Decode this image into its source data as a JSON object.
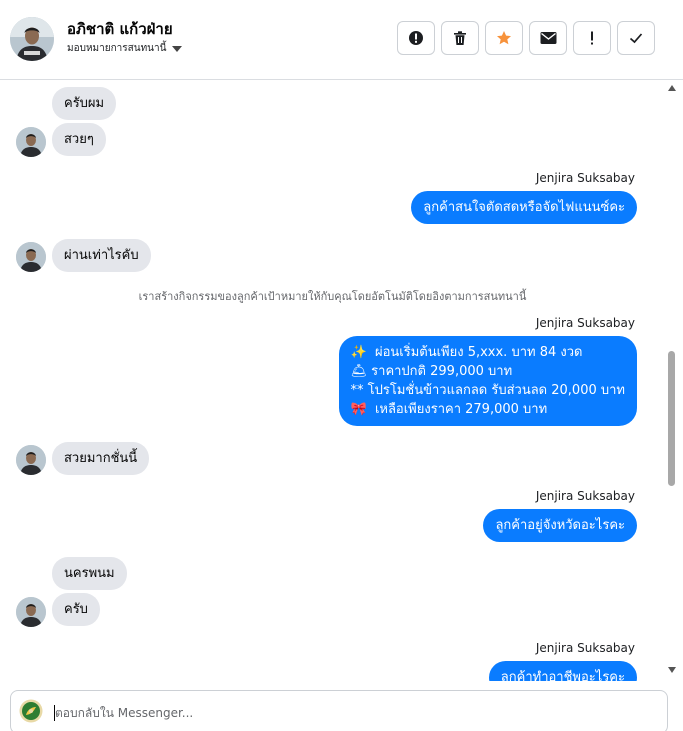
{
  "header": {
    "contact_name": "อภิชาติ แก้วฝ่าย",
    "assign_label": "มอบหมายการสนทนานี้",
    "actions": [
      {
        "icon": "alert-circle-icon",
        "name": "mark-spam-button"
      },
      {
        "icon": "trash-icon",
        "name": "delete-button"
      },
      {
        "icon": "star-icon",
        "name": "star-button"
      },
      {
        "icon": "envelope-icon",
        "name": "mark-unread-button"
      },
      {
        "icon": "exclamation-icon",
        "name": "follow-up-button"
      },
      {
        "icon": "check-icon",
        "name": "mark-done-button"
      }
    ]
  },
  "messages": {
    "m1": "ครับผม",
    "m2": "สวยๆ",
    "sender1": "Jenjira Suksabay",
    "m3": "ลูกค้าสนใจตัดสดหรือจัดไฟแนนซ์คะ",
    "m4": "ผ่านเท่าไรคับ",
    "system": "เราสร้างกิจกรรมของลูกค้าเป้าหมายให้กับคุณโดยอัตโนมัติโดยอิงตามการสนทนานี้",
    "sender2": "Jenjira Suksabay",
    "promo": {
      "line1_emoji": "✨",
      "line1": "ผ่อนเริ่มต้นเพียง 5,xxx. บาท 84 งวด",
      "line2_emoji": "🛎",
      "line2": "ราคาปกติ 299,000 บาท",
      "line3": "** โปรโมชั่นข้าวแลกลด รับส่วนลด 20,000 บาท",
      "line4_emoji": "🎀",
      "line4": "เหลือเพียงราคา 279,000 บาท"
    },
    "m5": "สวยมากชั่นนี้",
    "sender3": "Jenjira Suksabay",
    "m6": "ลูกค้าอยู่จังหวัดอะไรคะ",
    "m7": "นครพนม",
    "m8": "ครับ",
    "sender4": "Jenjira Suksabay",
    "m9": "ลูกค้าทำอาชีพอะไรคะ"
  },
  "composer": {
    "placeholder": "ตอบกลับใน Messenger..."
  },
  "colors": {
    "outgoing_bubble": "#0a7cff",
    "incoming_bubble": "#e4e6eb",
    "star": "#f7923b"
  }
}
